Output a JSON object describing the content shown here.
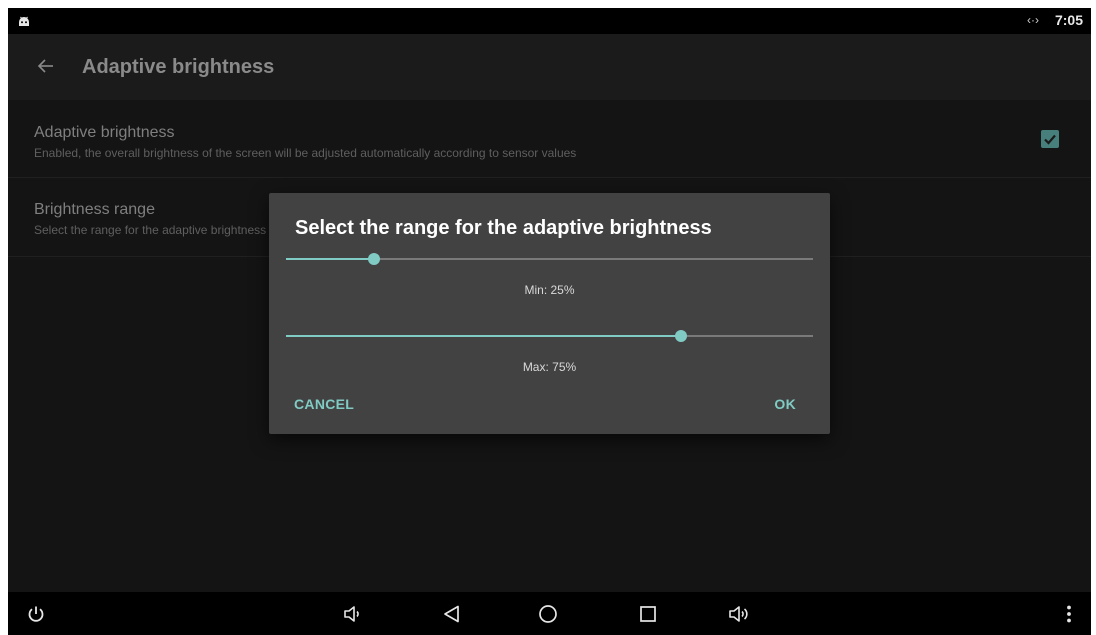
{
  "status_bar": {
    "time": "7:05",
    "network_glyph": "‹·›"
  },
  "app_bar": {
    "title": "Adaptive brightness"
  },
  "preferences": [
    {
      "title": "Adaptive brightness",
      "summary": "Enabled, the overall brightness of the screen will be adjusted automatically according to sensor values",
      "checked": true
    },
    {
      "title": "Brightness range",
      "summary": "Select the range for the adaptive brightness"
    }
  ],
  "dialog": {
    "title": "Select the range for the adaptive brightness",
    "min_percent": 25,
    "max_percent": 75,
    "min_label": "Min: 25%",
    "max_label": "Max: 75%",
    "cancel_label": "CANCEL",
    "ok_label": "OK"
  },
  "colors": {
    "accent": "#80cbc4",
    "dialog_bg": "#424242",
    "checkbox": "#467f7b"
  },
  "icons": [
    "android-icon",
    "back-arrow-icon",
    "power-icon",
    "volume-down-icon",
    "nav-back-icon",
    "nav-home-icon",
    "nav-recents-icon",
    "volume-up-icon",
    "more-vert-icon"
  ]
}
